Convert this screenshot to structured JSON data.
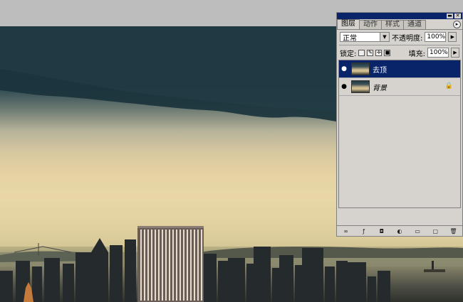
{
  "panel": {
    "tabs": [
      {
        "label": "图层"
      },
      {
        "label": "动作"
      },
      {
        "label": "样式"
      },
      {
        "label": "通道"
      }
    ],
    "blend_mode": "正常",
    "opacity_label": "不透明度:",
    "opacity_value": "100%",
    "lock_label": "锁定:",
    "fill_label": "填充:",
    "fill_value": "100%",
    "layers": [
      {
        "name": "去顶",
        "selected": true
      },
      {
        "name": "背景",
        "selected": false,
        "locked": true
      }
    ]
  },
  "icons": {
    "visibility": "eye-icon",
    "lock": "lock-icon",
    "menu": "panel-menu-icon"
  },
  "colors": {
    "selection": "#0a246a",
    "panel_bg": "#d6d3ce",
    "workspace_bg": "#bdbdbd"
  }
}
